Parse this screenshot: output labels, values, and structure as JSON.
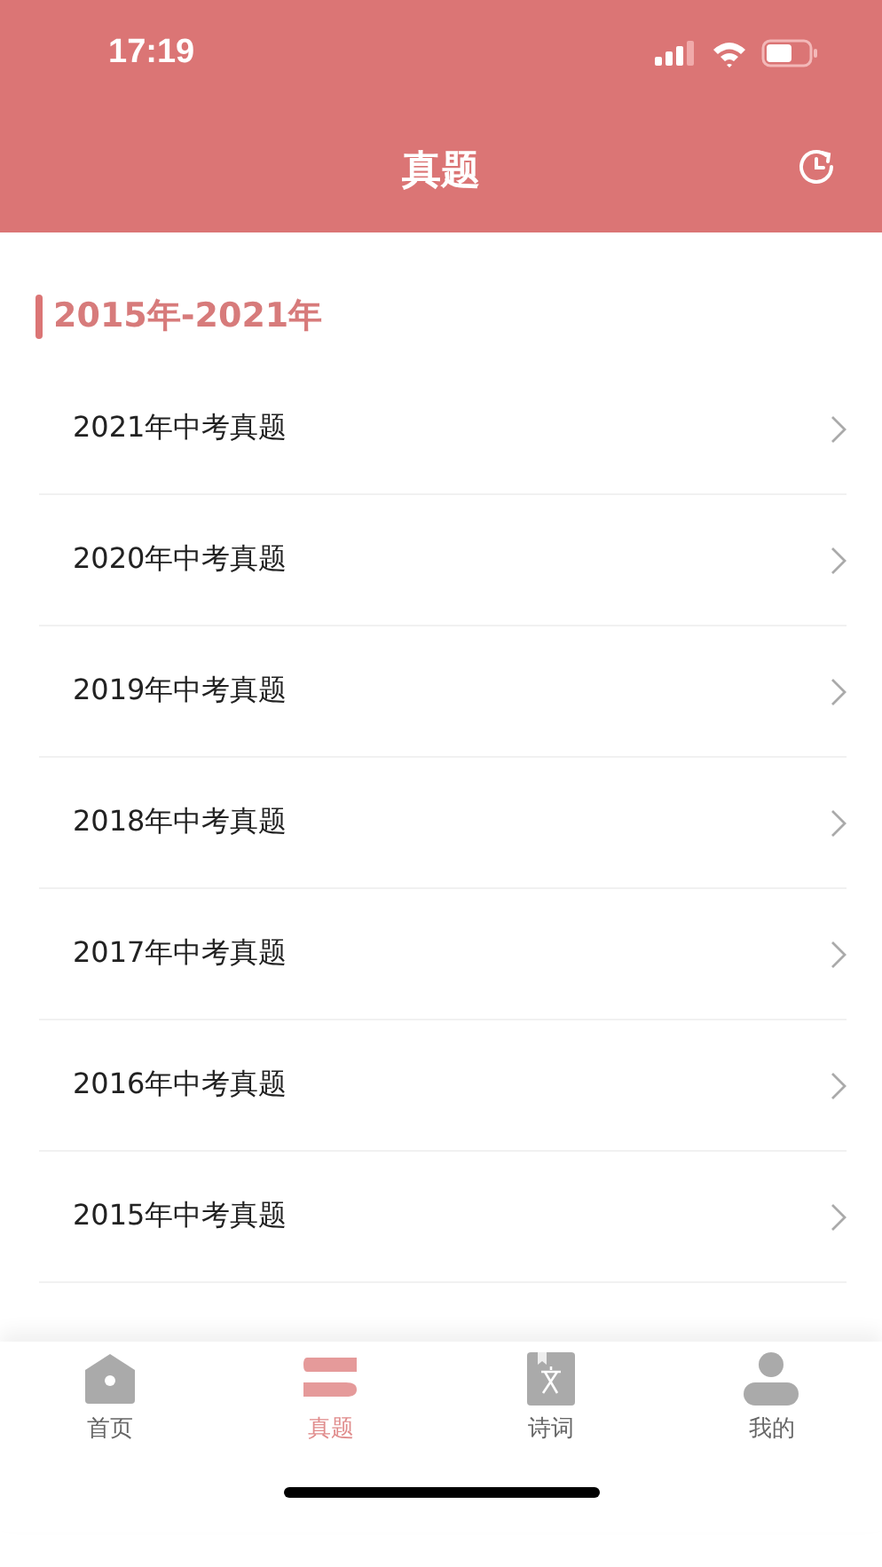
{
  "status_bar": {
    "time": "17:19"
  },
  "header": {
    "title": "真题"
  },
  "section": {
    "title": "2015年-2021年"
  },
  "items": [
    {
      "label": "2021年中考真题"
    },
    {
      "label": "2020年中考真题"
    },
    {
      "label": "2019年中考真题"
    },
    {
      "label": "2018年中考真题"
    },
    {
      "label": "2017年中考真题"
    },
    {
      "label": "2016年中考真题"
    },
    {
      "label": "2015年中考真题"
    }
  ],
  "tab_bar": [
    {
      "label": "首页",
      "selected": false
    },
    {
      "label": "真题",
      "selected": true
    },
    {
      "label": "诗词",
      "selected": false
    },
    {
      "label": "我的",
      "selected": false
    }
  ]
}
